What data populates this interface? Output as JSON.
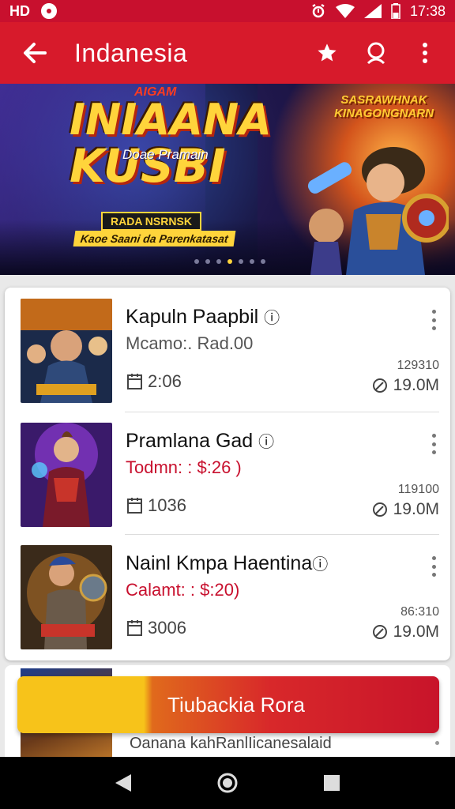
{
  "status_bar": {
    "left_text": "HD",
    "time": "17:38"
  },
  "app_bar": {
    "title": "Indanesia"
  },
  "banner": {
    "top_text": "AIGAM",
    "title_line1": "INIAANA",
    "title_line2": "KUSBI",
    "subtitle": "Doae Pramain",
    "ribbon": "RADA NSRNSK",
    "tagline": "Kaoe Saani da Parenkatasat",
    "logo_text": "SASRAWHNAK KINAGONGNARN",
    "slide_count": 7,
    "active_slide": 4
  },
  "items": [
    {
      "title": "Kapuln Paapbil",
      "subtitle": "Mcamo:. Rad.00",
      "subtitle_red": false,
      "count": "2:06",
      "small": "129310",
      "size": "19.0M"
    },
    {
      "title": "Pramlana Gad",
      "subtitle": "Todmn: : $:26 )",
      "subtitle_red": true,
      "count": "1036",
      "small": "119100",
      "size": "19.0M"
    },
    {
      "title": "Nainl Kmpa Haentina",
      "subtitle": "Calamt: : $:20)",
      "subtitle_red": true,
      "count": "3006",
      "small": "86:310",
      "size": "19.0M"
    }
  ],
  "peek_item": {
    "text": "Oanana kahRanlIicanesalaid"
  },
  "cta": {
    "label": "Tiubackia Rora"
  },
  "colors": {
    "primary": "#d71a2b",
    "status_bar": "#c8102e",
    "cta_yellow": "#f7c31a",
    "cta_red": "#c8142a"
  }
}
